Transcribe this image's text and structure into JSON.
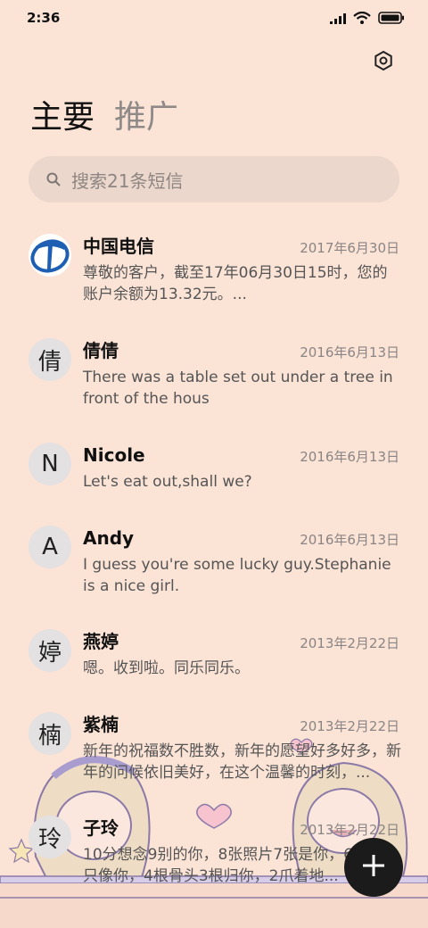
{
  "status": {
    "time": "2:36"
  },
  "icons": {
    "signal": "signal-icon",
    "wifi": "wifi-icon",
    "battery": "battery-icon",
    "settings": "settings-icon",
    "search": "search-icon",
    "compose": "plus-icon"
  },
  "tabs": [
    {
      "label": "主要",
      "active": true
    },
    {
      "label": "推广",
      "active": false
    }
  ],
  "search": {
    "placeholder": "搜索21条短信"
  },
  "conversations": [
    {
      "avatar": "",
      "name": "中国电信",
      "date": "2017年6月30日",
      "message": "尊敬的客户，截至17年06月30日15时，您的账户余额为13.32元。..."
    },
    {
      "avatar": "倩",
      "name": "倩倩",
      "date": "2016年6月13日",
      "message": "There was a table set out under a tree in front of the hous"
    },
    {
      "avatar": "N",
      "name": "Nicole",
      "date": "2016年6月13日",
      "message": "Let's eat out,shall we?"
    },
    {
      "avatar": "A",
      "name": "Andy",
      "date": "2016年6月13日",
      "message": "I guess you're some lucky guy.Stephanie is a nice girl."
    },
    {
      "avatar": "婷",
      "name": "燕婷",
      "date": "2013年2月22日",
      "message": "嗯。收到啦。同乐同乐。"
    },
    {
      "avatar": "楠",
      "name": "紫楠",
      "date": "2013年2月22日",
      "message": "新年的祝福数不胜数，新年的愿望好多好多，新年的问候依旧美好，在这个温馨的时刻，..."
    },
    {
      "avatar": "玲",
      "name": "子玲",
      "date": "2013年2月22日",
      "message": "10分想念9别的你，8张照片7张是你，6只狗5只像你，4根骨头3根归你，2爪着地..."
    }
  ],
  "colors": {
    "background": "#fbe3d6",
    "search_bg": "#ecd7cc",
    "avatar_bg": "#e4e1e2",
    "fab": "#1b1b1b",
    "brand_blue": "#1f5fb3"
  }
}
